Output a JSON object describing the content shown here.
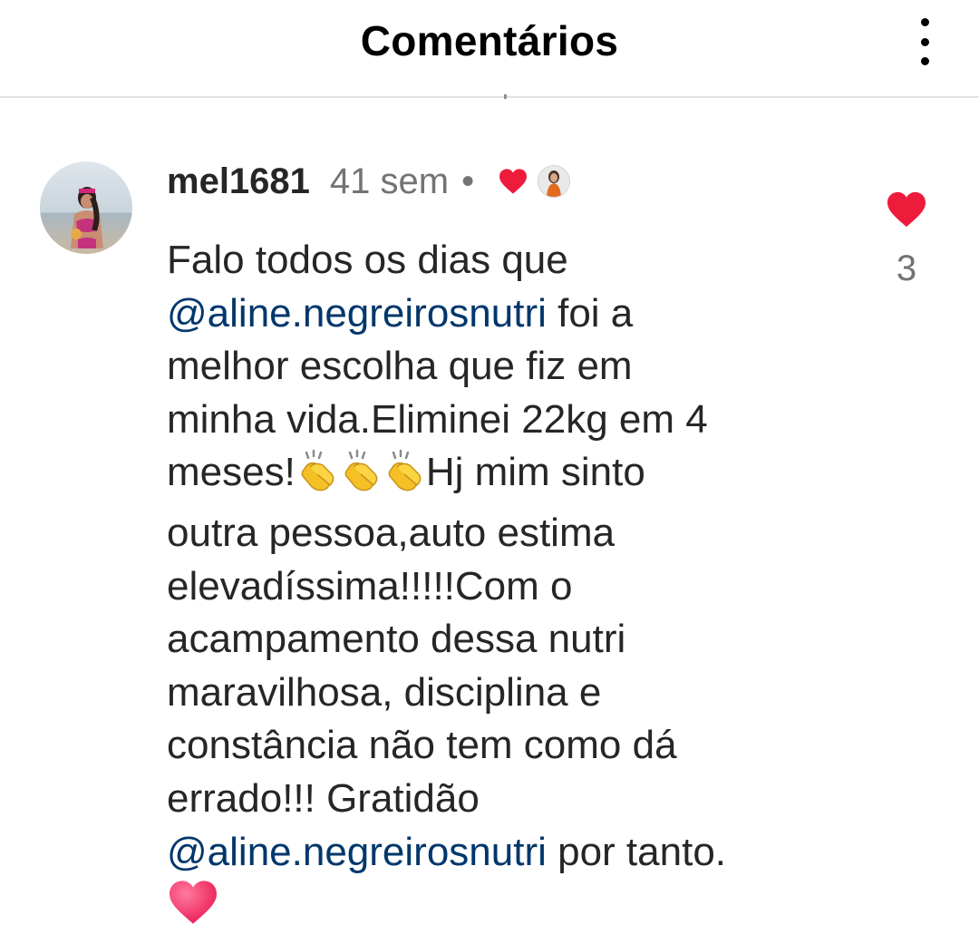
{
  "header": {
    "title": "Comentários",
    "menu_icon": "more-vertical-icon"
  },
  "comment": {
    "username": "mel1681",
    "time": "41 sem",
    "separator": "•",
    "author_liked_icon": "heart-icon",
    "like_count": "3",
    "lines": [
      [
        {
          "t": "Falo todos os dias que"
        }
      ],
      [
        {
          "t": "@aline.negreirosnutri",
          "m": true
        },
        {
          "t": " foi a"
        }
      ],
      [
        {
          "t": "melhor escolha que fiz em"
        }
      ],
      [
        {
          "t": "minha vida.Eliminei 22kg em 4"
        }
      ],
      [
        {
          "t": "meses!"
        },
        {
          "e": "clap"
        },
        {
          "e": "clap"
        },
        {
          "e": "clap"
        },
        {
          "t": "Hj mim sinto"
        }
      ],
      [
        {
          "t": "outra pessoa,auto estima"
        }
      ],
      [
        {
          "t": "elevadíssima!!!!!Com o"
        }
      ],
      [
        {
          "t": "acampamento dessa nutri"
        }
      ],
      [
        {
          "t": "maravilhosa, disciplina e"
        }
      ],
      [
        {
          "t": "constância não tem como dá"
        }
      ],
      [
        {
          "t": "errado!!! Gratidão"
        }
      ],
      [
        {
          "t": "@aline.negreirosnutri",
          "m": true
        },
        {
          "t": "  por tanto."
        }
      ],
      [
        {
          "e": "heart"
        }
      ]
    ]
  },
  "colors": {
    "like_red": "#ed1c3b",
    "mention_blue": "#00376b",
    "secondary_text": "#737373"
  }
}
